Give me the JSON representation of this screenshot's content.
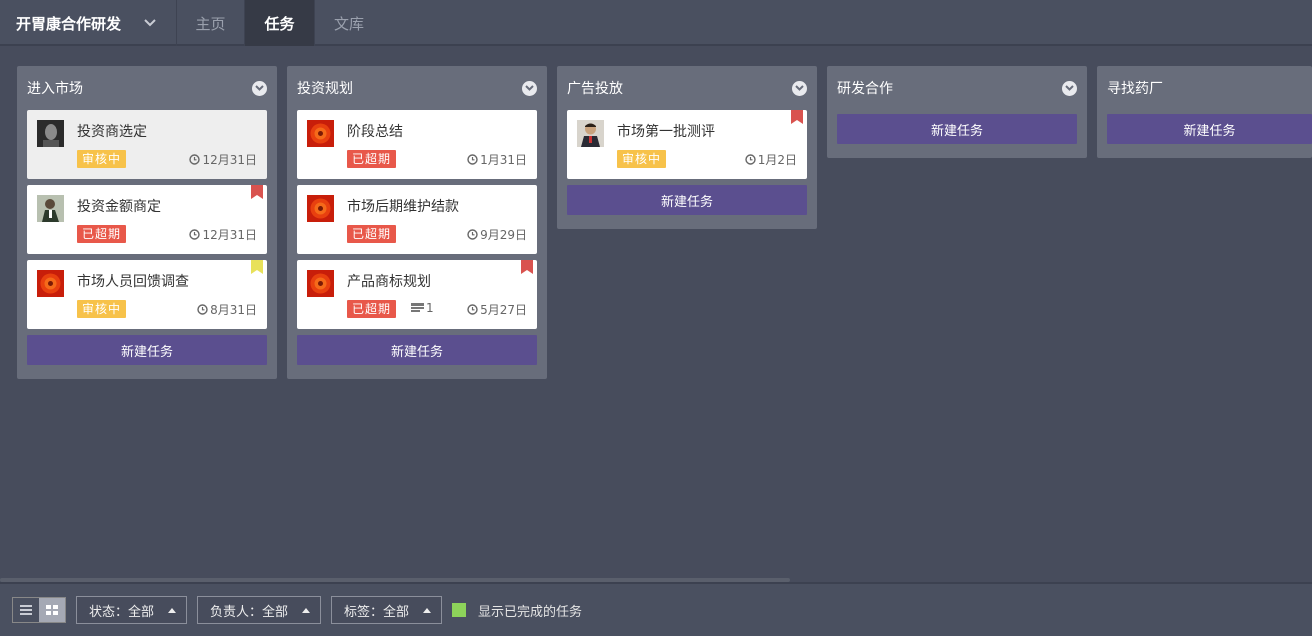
{
  "nav": {
    "project": "开胃康合作研发",
    "tabs": [
      "主页",
      "任务",
      "文库"
    ]
  },
  "colors": {
    "pending": "#f7c24a",
    "overdue": "#e8584a",
    "new_task": "#5b4f8f",
    "flag_red": "#d9534f",
    "flag_yellow": "#e8e15a",
    "done_check": "#8dd35a"
  },
  "columns": [
    {
      "title": "进入市场",
      "new_task_label": "新建任务",
      "cards": [
        {
          "title": "投资商选定",
          "status": "审核中",
          "due": "12月31日",
          "avatar": "man-dark-avatar",
          "flag": ""
        },
        {
          "title": "投资金额商定",
          "status": "已超期",
          "due": "12月31日",
          "avatar": "man-suit-avatar",
          "flag": "red"
        },
        {
          "title": "市场人员回馈调查",
          "status": "审核中",
          "due": "8月31日",
          "avatar": "flower-avatar",
          "flag": "yellow"
        }
      ]
    },
    {
      "title": "投资规划",
      "new_task_label": "新建任务",
      "cards": [
        {
          "title": "阶段总结",
          "status": "已超期",
          "due": "1月31日",
          "avatar": "flower-avatar",
          "flag": ""
        },
        {
          "title": "市场后期维护结款",
          "status": "已超期",
          "due": "9月29日",
          "avatar": "flower-avatar",
          "flag": ""
        },
        {
          "title": "产品商标规划",
          "status": "已超期",
          "due": "5月27日",
          "avatar": "flower-avatar",
          "flag": "red",
          "comments": "1"
        }
      ]
    },
    {
      "title": "广告投放",
      "new_task_label": "新建任务",
      "cards": [
        {
          "title": "市场第一批测评",
          "status": "审核中",
          "due": "1月2日",
          "avatar": "businessman-avatar",
          "flag": "red"
        }
      ]
    },
    {
      "title": "研发合作",
      "new_task_label": "新建任务",
      "cards": []
    },
    {
      "title": "寻找药厂",
      "new_task_label": "新建任务",
      "cards": []
    }
  ],
  "footer": {
    "filters": [
      "状态：全部",
      "负责人：全部",
      "标签：全部"
    ],
    "show_completed": "显示已完成的任务"
  }
}
